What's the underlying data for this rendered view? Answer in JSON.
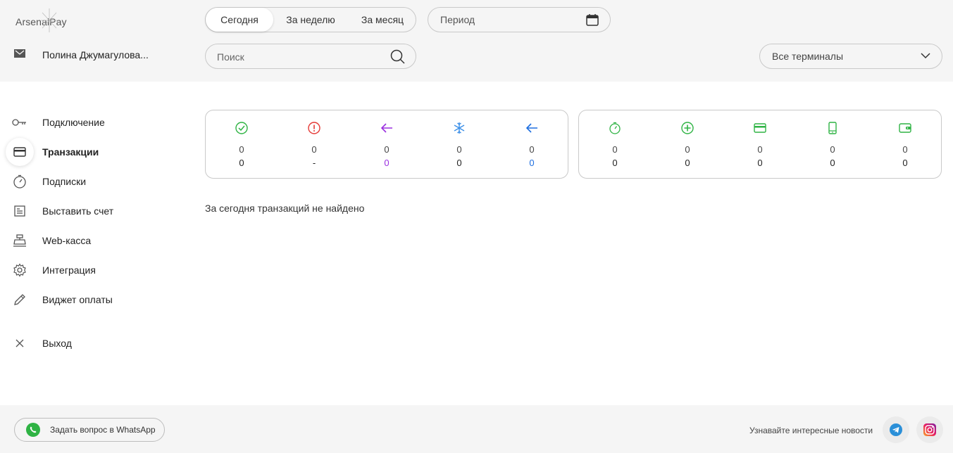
{
  "app": {
    "logo_text": "ArsenalPay",
    "user_name": "Полина Джумагулова..."
  },
  "header": {
    "period_tabs": [
      {
        "label": "Сегодня",
        "active": true
      },
      {
        "label": "За неделю",
        "active": false
      },
      {
        "label": "За месяц",
        "active": false
      }
    ],
    "period_placeholder": "Период",
    "search_placeholder": "Поиск",
    "terminals_selected": "Все терминалы"
  },
  "sidebar": {
    "items": [
      {
        "label": "Подключение",
        "icon": "key-icon",
        "active": false
      },
      {
        "label": "Транзакции",
        "icon": "card-icon",
        "active": true
      },
      {
        "label": "Подписки",
        "icon": "stopwatch-icon",
        "active": false
      },
      {
        "label": "Выставить счет",
        "icon": "invoice-icon",
        "active": false
      },
      {
        "label": "Web-касса",
        "icon": "cash-register-icon",
        "active": false
      },
      {
        "label": "Интеграция",
        "icon": "gear-icon",
        "active": false
      },
      {
        "label": "Виджет оплаты",
        "icon": "pencil-icon",
        "active": false
      }
    ],
    "logout_label": "Выход"
  },
  "stats": {
    "status_card": [
      {
        "icon": "check-circle-icon",
        "color": "#2fb344",
        "count": "0",
        "amount": "0",
        "amount_color": "#222222"
      },
      {
        "icon": "error-circle-icon",
        "color": "#e53935",
        "count": "0",
        "amount": "-",
        "amount_color": "#222222"
      },
      {
        "icon": "arrow-left-icon",
        "color": "#9b30e0",
        "count": "0",
        "amount": "0",
        "amount_color": "#9b30e0"
      },
      {
        "icon": "snowflake-icon",
        "color": "#3b8fe8",
        "count": "0",
        "amount": "0",
        "amount_color": "#222222"
      },
      {
        "icon": "arrow-left-icon",
        "color": "#1e6fe0",
        "count": "0",
        "amount": "0",
        "amount_color": "#1e6fe0"
      }
    ],
    "method_card": [
      {
        "icon": "stopwatch-icon",
        "color": "#2fb344",
        "count": "0",
        "amount": "0"
      },
      {
        "icon": "plus-circle-icon",
        "color": "#2fb344",
        "count": "0",
        "amount": "0"
      },
      {
        "icon": "card-icon",
        "color": "#2fb344",
        "count": "0",
        "amount": "0"
      },
      {
        "icon": "phone-icon",
        "color": "#2fb344",
        "count": "0",
        "amount": "0"
      },
      {
        "icon": "wallet-icon",
        "color": "#2fb344",
        "count": "0",
        "amount": "0"
      }
    ]
  },
  "main": {
    "empty_message": "За сегодня транзакций не найдено"
  },
  "footer": {
    "whatsapp_label": "Задать вопрос в WhatsApp",
    "news_label": "Узнавайте интересные новости",
    "social": [
      "telegram-icon",
      "instagram-icon"
    ]
  }
}
